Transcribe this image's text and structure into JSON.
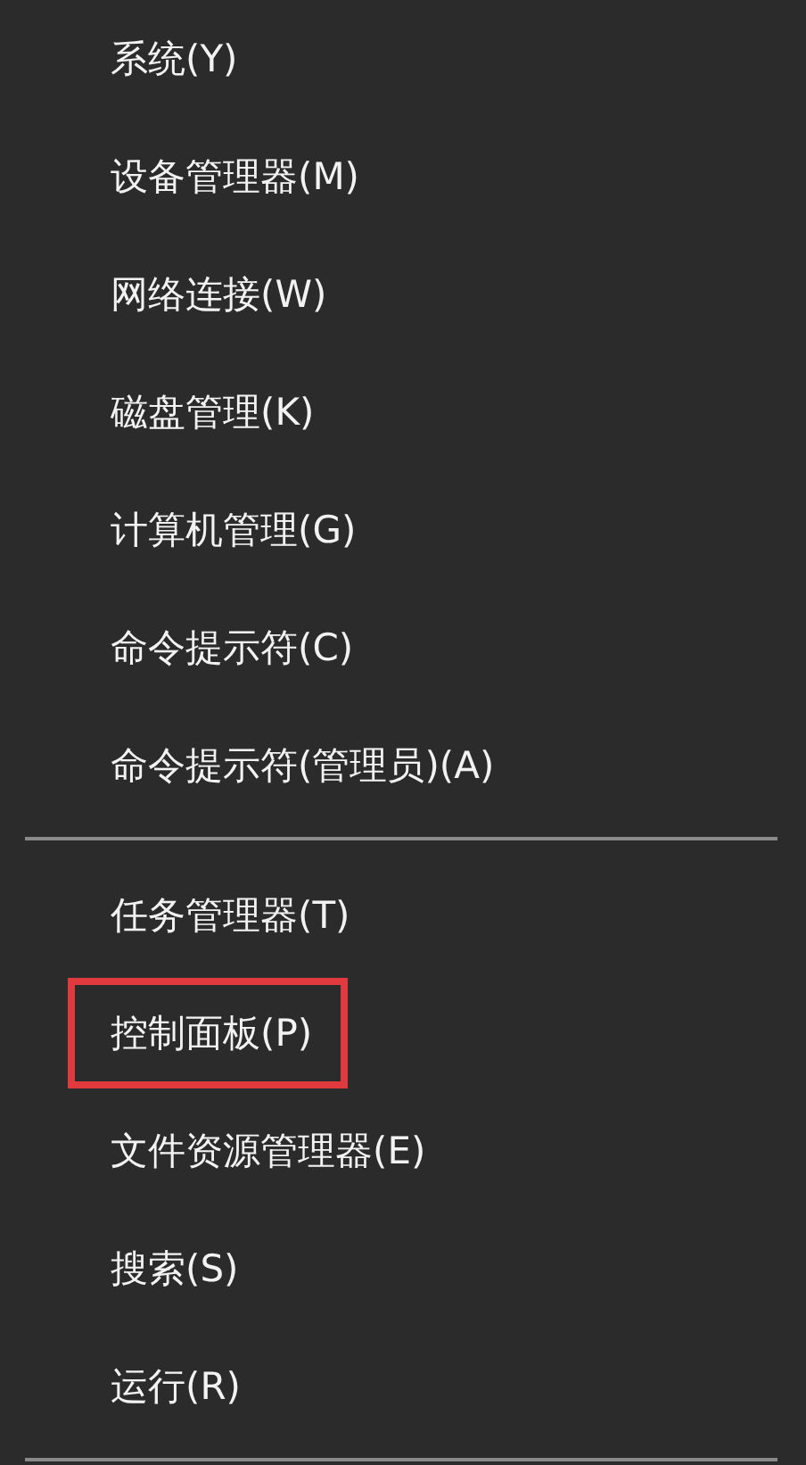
{
  "menu": {
    "sections": [
      {
        "items": [
          {
            "label": "系统(Y)",
            "highlighted": false
          },
          {
            "label": "设备管理器(M)",
            "highlighted": false
          },
          {
            "label": "网络连接(W)",
            "highlighted": false
          },
          {
            "label": "磁盘管理(K)",
            "highlighted": false
          },
          {
            "label": "计算机管理(G)",
            "highlighted": false
          },
          {
            "label": "命令提示符(C)",
            "highlighted": false
          },
          {
            "label": "命令提示符(管理员)(A)",
            "highlighted": false
          }
        ]
      },
      {
        "items": [
          {
            "label": "任务管理器(T)",
            "highlighted": false
          },
          {
            "label": "控制面板(P)",
            "highlighted": true
          },
          {
            "label": "文件资源管理器(E)",
            "highlighted": false
          },
          {
            "label": "搜索(S)",
            "highlighted": false
          },
          {
            "label": "运行(R)",
            "highlighted": false
          }
        ]
      }
    ]
  }
}
